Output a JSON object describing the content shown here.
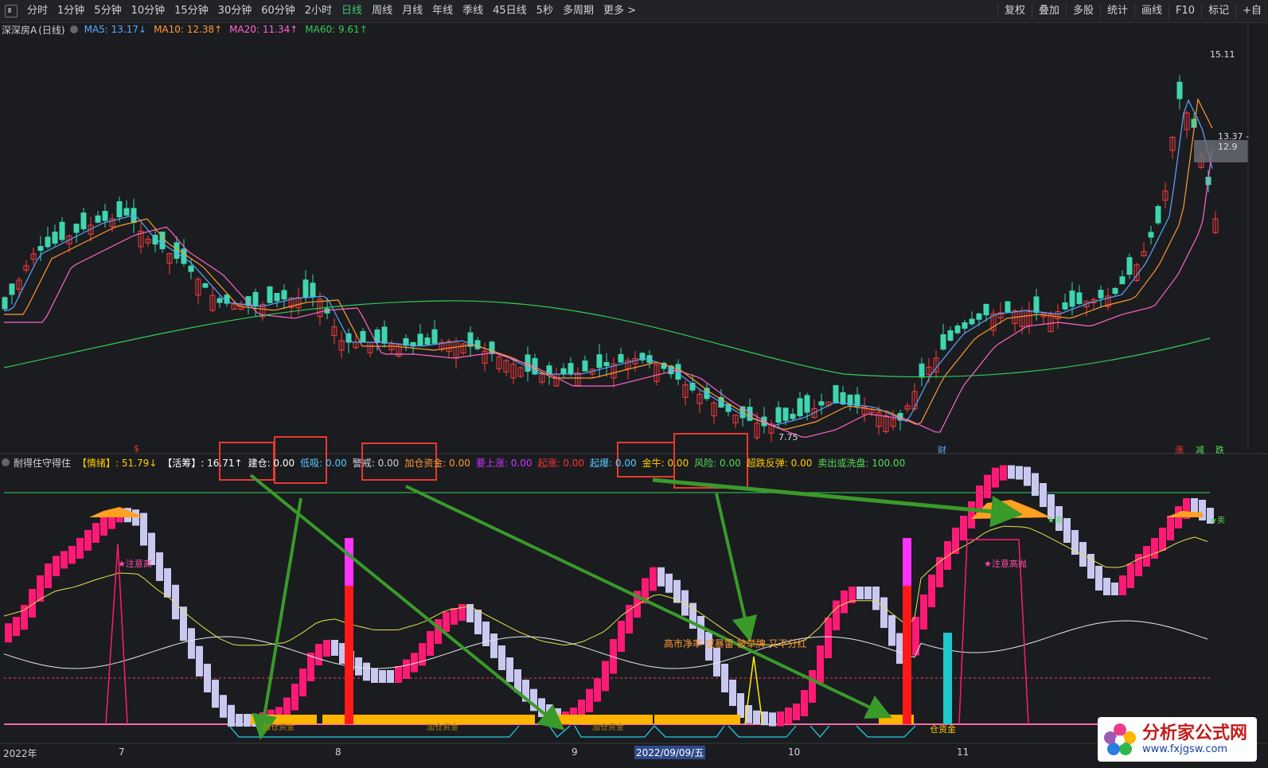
{
  "toolbar": {
    "periods": [
      "分时",
      "1分钟",
      "5分钟",
      "10分钟",
      "15分钟",
      "30分钟",
      "60分钟",
      "2小时",
      "日线",
      "周线",
      "月线",
      "年线",
      "季线",
      "45日线",
      "5秒",
      "多周期",
      "更多 >"
    ],
    "active_period": "日线",
    "right_tools": [
      "复权",
      "叠加",
      "多股",
      "统计",
      "画线",
      "F10",
      "标记",
      "+自"
    ]
  },
  "stock": {
    "name": "深深房A",
    "period_label": "(日线)"
  },
  "ma_legend": [
    {
      "label": "MA5: 13.17↓",
      "color": "#5aa7ff"
    },
    {
      "label": "MA10: 12.38↑",
      "color": "#ff9933"
    },
    {
      "label": "MA20: 11.34↑",
      "color": "#ff66cc"
    },
    {
      "label": "MA60: 9.61↑",
      "color": "#33cc55"
    }
  ],
  "price_labels": {
    "high": "15.11",
    "low": "7.75",
    "range": "13.37 - 12.9"
  },
  "event_markers": {
    "s": "$",
    "cai": "财",
    "zhang": "涨",
    "jian": "减",
    "die": "跌"
  },
  "indicator": {
    "name": "耐得住守得住",
    "items": [
      {
        "label": "【情绪】: 51.79↓",
        "color": "#ffcc00"
      },
      {
        "label": "【活筹】: 16.71↑",
        "color": "#ffffff"
      },
      {
        "label": "建仓: 0.00",
        "color": "#ffffff"
      },
      {
        "label": "低吸: 0.00",
        "color": "#55ccff"
      },
      {
        "label": "警戒: 0.00",
        "color": "#cfd3da"
      },
      {
        "label": "加仓资金: 0.00",
        "color": "#ff9933"
      },
      {
        "label": "要上涨: 0.00",
        "color": "#cc33ff"
      },
      {
        "label": "起涨: 0.00",
        "color": "#ff3333"
      },
      {
        "label": "起爆: 0.00",
        "color": "#55ccff"
      },
      {
        "label": "金牛: 0.00",
        "color": "#ffcc00"
      },
      {
        "label": "风险: 0.00",
        "color": "#55dd55"
      },
      {
        "label": "超跌反弹: 0.00",
        "color": "#ffcc00"
      },
      {
        "label": "卖出或洗盘: 100.00",
        "color": "#55dd55"
      }
    ]
  },
  "annotations": {
    "high_alert_1": "★注意高",
    "high_alert_2": "★注意高抛",
    "sell_1": "★卖",
    "sell_2": "★卖",
    "add_fund_1": "加仓资金",
    "add_fund_2": "加仓资金",
    "add_fund_3": "加仓资金",
    "add_fund_4": "仓资金",
    "news": "高市净率 或暴雷 被举牌 又不分红"
  },
  "dates": {
    "year": "2022年",
    "m7": "7",
    "m8": "8",
    "m9": "9",
    "m10": "10",
    "m11": "11",
    "cursor": "2022/09/09/五"
  },
  "watermark": {
    "cn": "分析家公式网",
    "url": "www.fxjgsw.com"
  }
}
